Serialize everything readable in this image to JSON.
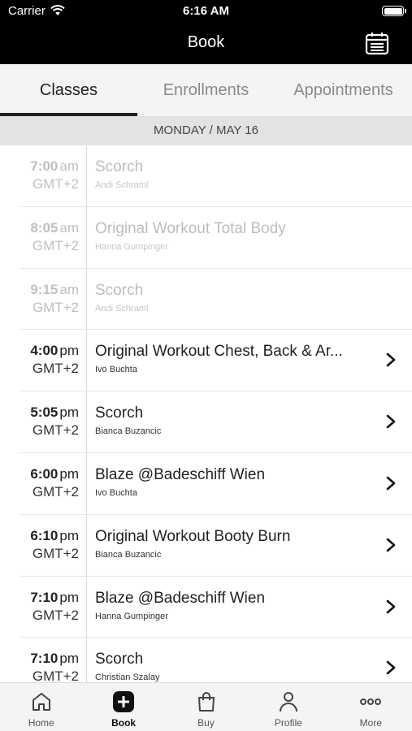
{
  "status_bar": {
    "carrier": "Carrier",
    "time": "6:16 AM"
  },
  "header": {
    "title": "Book"
  },
  "tabs": [
    {
      "label": "Classes",
      "active": true
    },
    {
      "label": "Enrollments",
      "active": false
    },
    {
      "label": "Appointments",
      "active": false
    }
  ],
  "date_header": "MONDAY / MAY 16",
  "classes": [
    {
      "time": "7:00",
      "ampm": "am",
      "tz": "GMT+2",
      "name": "Scorch",
      "instructor": "Andi Schraml",
      "past": true
    },
    {
      "time": "8:05",
      "ampm": "am",
      "tz": "GMT+2",
      "name": "Original Workout Total Body",
      "instructor": "Hanna Gumpinger",
      "past": true
    },
    {
      "time": "9:15",
      "ampm": "am",
      "tz": "GMT+2",
      "name": "Scorch",
      "instructor": "Andi Schraml",
      "past": true
    },
    {
      "time": "4:00",
      "ampm": "pm",
      "tz": "GMT+2",
      "name": "Original Workout Chest, Back & Ar...",
      "instructor": "Ivo Buchta",
      "past": false
    },
    {
      "time": "5:05",
      "ampm": "pm",
      "tz": "GMT+2",
      "name": "Scorch",
      "instructor": "Bianca Buzancic",
      "past": false
    },
    {
      "time": "6:00",
      "ampm": "pm",
      "tz": "GMT+2",
      "name": "Blaze @Badeschiff Wien",
      "instructor": "Ivo Buchta",
      "past": false
    },
    {
      "time": "6:10",
      "ampm": "pm",
      "tz": "GMT+2",
      "name": "Original Workout Booty Burn",
      "instructor": "Bianca Buzancic",
      "past": false
    },
    {
      "time": "7:10",
      "ampm": "pm",
      "tz": "GMT+2",
      "name": "Blaze @Badeschiff Wien",
      "instructor": "Hanna Gumpinger",
      "past": false
    },
    {
      "time": "7:10",
      "ampm": "pm",
      "tz": "GMT+2",
      "name": "Scorch",
      "instructor": "Christian Szalay",
      "past": false
    }
  ],
  "bottom_nav": [
    {
      "label": "Home",
      "icon": "home-icon",
      "active": false
    },
    {
      "label": "Book",
      "icon": "book-plus-icon",
      "active": true
    },
    {
      "label": "Buy",
      "icon": "shopping-bag-icon",
      "active": false
    },
    {
      "label": "Profile",
      "icon": "person-icon",
      "active": false
    },
    {
      "label": "More",
      "icon": "more-dots-icon",
      "active": false
    }
  ]
}
